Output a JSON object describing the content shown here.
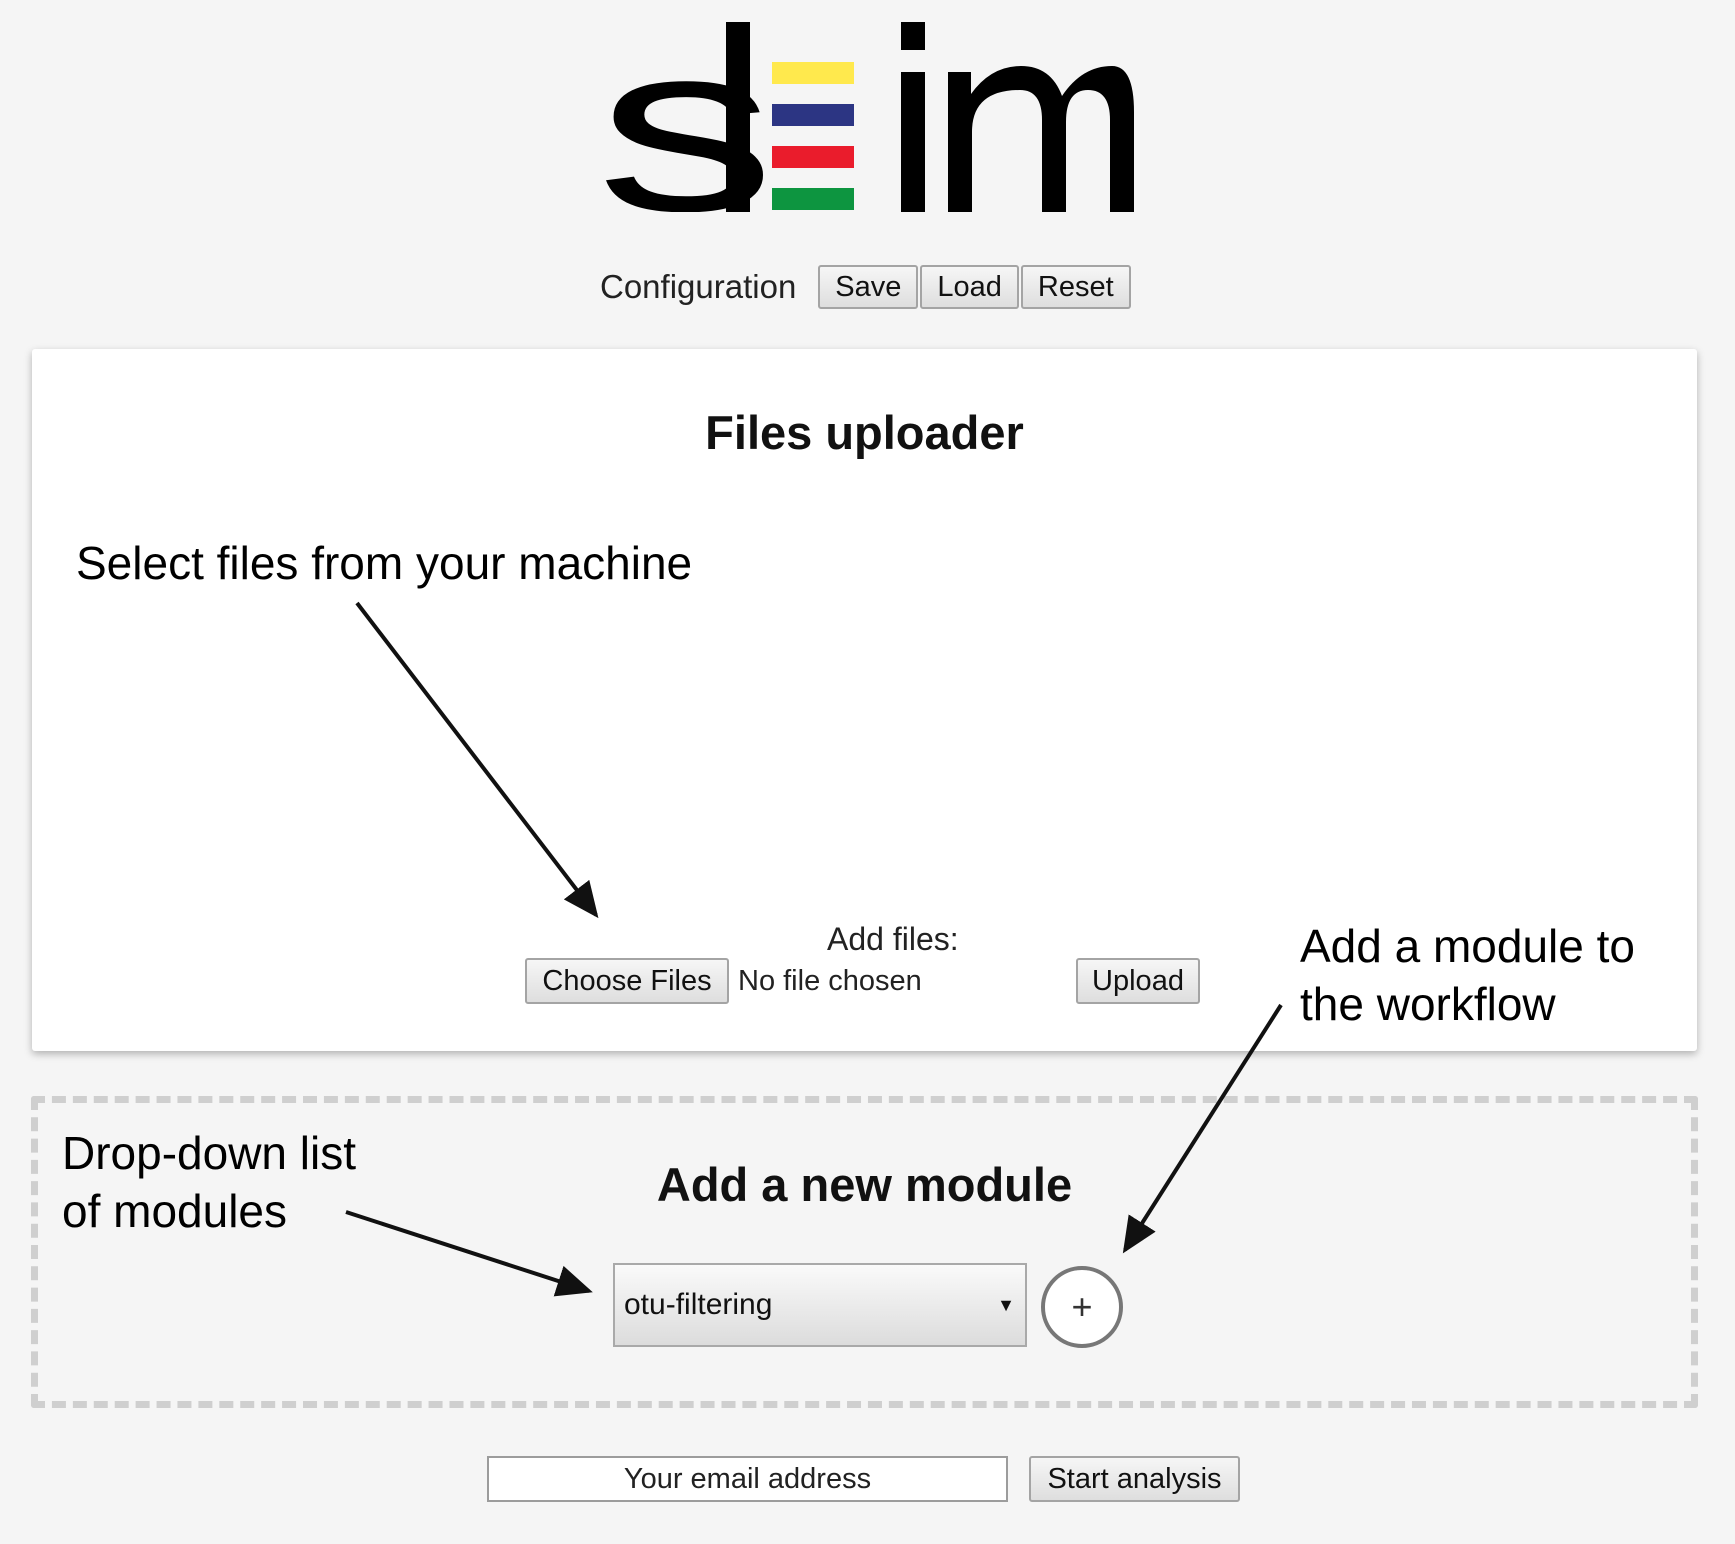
{
  "app": {
    "logo_text": "sleim",
    "logo_bar_colors": [
      "#ffe94d",
      "#2c3583",
      "#ea1c2c",
      "#0d9540"
    ]
  },
  "config": {
    "label": "Configuration",
    "save_label": "Save",
    "load_label": "Load",
    "reset_label": "Reset"
  },
  "uploader": {
    "title": "Files uploader",
    "add_files_label": "Add files:",
    "choose_files_label": "Choose Files",
    "no_file_text": "No file chosen",
    "upload_label": "Upload"
  },
  "module_panel": {
    "title": "Add a new module",
    "selected_module": "otu-filtering",
    "add_button_symbol": "+"
  },
  "footer": {
    "email_placeholder": "Your email address",
    "start_label": "Start analysis"
  },
  "annotations": {
    "select_files": "Select files from your machine",
    "add_module_line1": "Add a module to",
    "add_module_line2": "the workflow",
    "dropdown_line1": "Drop-down list",
    "dropdown_line2": "of modules"
  }
}
